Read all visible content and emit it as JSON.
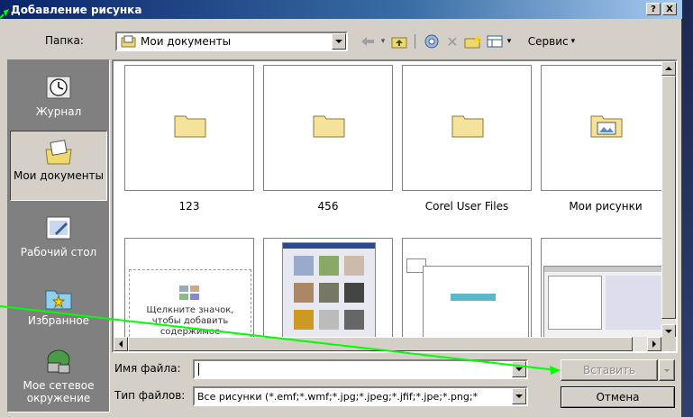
{
  "titlebar": {
    "title": "Добавление рисунка",
    "help_label": "?",
    "close_label": "X"
  },
  "folder_label": "Папка:",
  "folder_combo": {
    "value": "Мои документы"
  },
  "toolbar": {
    "service_label": "Сервис"
  },
  "places": [
    {
      "label": "Журнал",
      "icon": "history-icon"
    },
    {
      "label": "Мои документы",
      "icon": "my-documents-icon"
    },
    {
      "label": "Рабочий стол",
      "icon": "desktop-icon"
    },
    {
      "label": "Избранное",
      "icon": "favorites-icon"
    },
    {
      "label": "Мое сетевое окружение",
      "icon": "network-icon"
    }
  ],
  "files": [
    {
      "name": "123",
      "kind": "folder"
    },
    {
      "name": "456",
      "kind": "folder"
    },
    {
      "name": "Corel User Files",
      "kind": "folder"
    },
    {
      "name": "Мои рисунки",
      "kind": "picture-folder"
    }
  ],
  "placeholder_thumb_text": "Щелкните значок, чтобы добавить содержимое",
  "filename_label": "Имя файла:",
  "filename_value": "",
  "filetype_label": "Тип файлов:",
  "filetype_value": "Все рисунки (*.emf;*.wmf;*.jpg;*.jpeg;*.jfif;*.jpe;*.png;*",
  "buttons": {
    "insert_label": "Вставить",
    "cancel_label": "Отмена"
  },
  "colors": {
    "title_start": "#0a246a",
    "title_end": "#a6caf0",
    "annotation_arrow": "#00ff00"
  }
}
